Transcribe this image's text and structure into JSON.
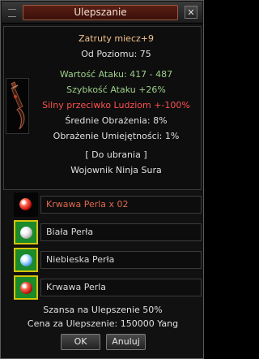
{
  "window": {
    "title": "Ulepszanie",
    "close_glyph": "✕"
  },
  "item": {
    "icon": "sword-icon",
    "name": "Zatruty miecz+9",
    "level_req": "Od Poziomu: 75",
    "attack_value": "Wartość Ataku: 417 - 487",
    "attack_speed": "Szybkość Ataku +26%",
    "strong_vs": "Silny przeciwko Ludziom +-100%",
    "avg_damage": "Średnie Obrażenia: 8%",
    "skill_damage": "Obrażenie Umiejętności: 1%",
    "equip": "[ Do ubrania ]",
    "classes": "Wojownik Ninja Sura"
  },
  "materials": [
    {
      "label": "Krwawa Perla x 02",
      "icon": "red-pearl-icon",
      "required": true
    },
    {
      "label": "Biała Perła",
      "icon": "white-pearl-icon",
      "required": false
    },
    {
      "label": "Niebieska Perła",
      "icon": "blue-pearl-icon",
      "required": false
    },
    {
      "label": "Krwawa Perla",
      "icon": "red-pearl-icon",
      "required": false
    }
  ],
  "chance": "Szansa na Ulepszenie 50%",
  "cost": "Cena za Ulepszenie: 150000 Yang",
  "buttons": {
    "ok": "OK",
    "cancel": "Anuluj"
  },
  "colors": {
    "name": "#f3c08c",
    "stat_green": "#9ed08a",
    "stat_red": "#ff5050",
    "required_material": "#e06a50",
    "slot_border": "#d6c20a",
    "slot_fill": "#1a8a2a"
  }
}
